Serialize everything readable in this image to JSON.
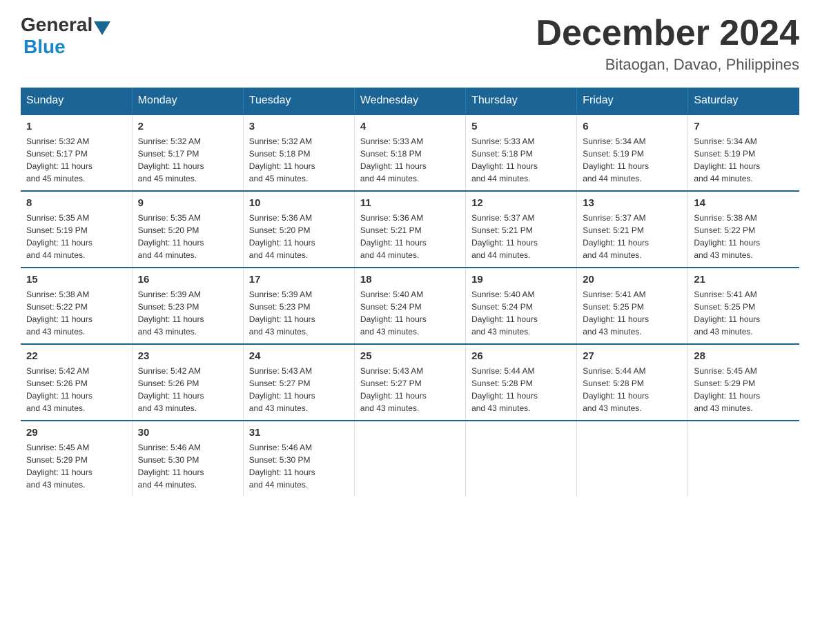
{
  "logo": {
    "general": "General",
    "blue": "Blue"
  },
  "header": {
    "month_year": "December 2024",
    "location": "Bitaogan, Davao, Philippines"
  },
  "days_of_week": [
    "Sunday",
    "Monday",
    "Tuesday",
    "Wednesday",
    "Thursday",
    "Friday",
    "Saturday"
  ],
  "weeks": [
    [
      {
        "day": "1",
        "sunrise": "5:32 AM",
        "sunset": "5:17 PM",
        "daylight": "11 hours and 45 minutes."
      },
      {
        "day": "2",
        "sunrise": "5:32 AM",
        "sunset": "5:17 PM",
        "daylight": "11 hours and 45 minutes."
      },
      {
        "day": "3",
        "sunrise": "5:32 AM",
        "sunset": "5:18 PM",
        "daylight": "11 hours and 45 minutes."
      },
      {
        "day": "4",
        "sunrise": "5:33 AM",
        "sunset": "5:18 PM",
        "daylight": "11 hours and 44 minutes."
      },
      {
        "day": "5",
        "sunrise": "5:33 AM",
        "sunset": "5:18 PM",
        "daylight": "11 hours and 44 minutes."
      },
      {
        "day": "6",
        "sunrise": "5:34 AM",
        "sunset": "5:19 PM",
        "daylight": "11 hours and 44 minutes."
      },
      {
        "day": "7",
        "sunrise": "5:34 AM",
        "sunset": "5:19 PM",
        "daylight": "11 hours and 44 minutes."
      }
    ],
    [
      {
        "day": "8",
        "sunrise": "5:35 AM",
        "sunset": "5:19 PM",
        "daylight": "11 hours and 44 minutes."
      },
      {
        "day": "9",
        "sunrise": "5:35 AM",
        "sunset": "5:20 PM",
        "daylight": "11 hours and 44 minutes."
      },
      {
        "day": "10",
        "sunrise": "5:36 AM",
        "sunset": "5:20 PM",
        "daylight": "11 hours and 44 minutes."
      },
      {
        "day": "11",
        "sunrise": "5:36 AM",
        "sunset": "5:21 PM",
        "daylight": "11 hours and 44 minutes."
      },
      {
        "day": "12",
        "sunrise": "5:37 AM",
        "sunset": "5:21 PM",
        "daylight": "11 hours and 44 minutes."
      },
      {
        "day": "13",
        "sunrise": "5:37 AM",
        "sunset": "5:21 PM",
        "daylight": "11 hours and 44 minutes."
      },
      {
        "day": "14",
        "sunrise": "5:38 AM",
        "sunset": "5:22 PM",
        "daylight": "11 hours and 43 minutes."
      }
    ],
    [
      {
        "day": "15",
        "sunrise": "5:38 AM",
        "sunset": "5:22 PM",
        "daylight": "11 hours and 43 minutes."
      },
      {
        "day": "16",
        "sunrise": "5:39 AM",
        "sunset": "5:23 PM",
        "daylight": "11 hours and 43 minutes."
      },
      {
        "day": "17",
        "sunrise": "5:39 AM",
        "sunset": "5:23 PM",
        "daylight": "11 hours and 43 minutes."
      },
      {
        "day": "18",
        "sunrise": "5:40 AM",
        "sunset": "5:24 PM",
        "daylight": "11 hours and 43 minutes."
      },
      {
        "day": "19",
        "sunrise": "5:40 AM",
        "sunset": "5:24 PM",
        "daylight": "11 hours and 43 minutes."
      },
      {
        "day": "20",
        "sunrise": "5:41 AM",
        "sunset": "5:25 PM",
        "daylight": "11 hours and 43 minutes."
      },
      {
        "day": "21",
        "sunrise": "5:41 AM",
        "sunset": "5:25 PM",
        "daylight": "11 hours and 43 minutes."
      }
    ],
    [
      {
        "day": "22",
        "sunrise": "5:42 AM",
        "sunset": "5:26 PM",
        "daylight": "11 hours and 43 minutes."
      },
      {
        "day": "23",
        "sunrise": "5:42 AM",
        "sunset": "5:26 PM",
        "daylight": "11 hours and 43 minutes."
      },
      {
        "day": "24",
        "sunrise": "5:43 AM",
        "sunset": "5:27 PM",
        "daylight": "11 hours and 43 minutes."
      },
      {
        "day": "25",
        "sunrise": "5:43 AM",
        "sunset": "5:27 PM",
        "daylight": "11 hours and 43 minutes."
      },
      {
        "day": "26",
        "sunrise": "5:44 AM",
        "sunset": "5:28 PM",
        "daylight": "11 hours and 43 minutes."
      },
      {
        "day": "27",
        "sunrise": "5:44 AM",
        "sunset": "5:28 PM",
        "daylight": "11 hours and 43 minutes."
      },
      {
        "day": "28",
        "sunrise": "5:45 AM",
        "sunset": "5:29 PM",
        "daylight": "11 hours and 43 minutes."
      }
    ],
    [
      {
        "day": "29",
        "sunrise": "5:45 AM",
        "sunset": "5:29 PM",
        "daylight": "11 hours and 43 minutes."
      },
      {
        "day": "30",
        "sunrise": "5:46 AM",
        "sunset": "5:30 PM",
        "daylight": "11 hours and 44 minutes."
      },
      {
        "day": "31",
        "sunrise": "5:46 AM",
        "sunset": "5:30 PM",
        "daylight": "11 hours and 44 minutes."
      },
      null,
      null,
      null,
      null
    ]
  ],
  "labels": {
    "sunrise": "Sunrise:",
    "sunset": "Sunset:",
    "daylight": "Daylight:"
  }
}
